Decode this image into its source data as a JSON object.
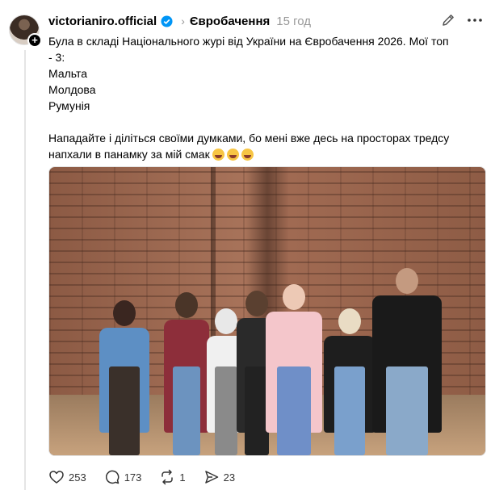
{
  "post": {
    "username": "victorianiro.official",
    "community": "Євробачення",
    "time": "15 год",
    "text_lines": [
      "Була в складі Національного журі від України на Євробачення 2026. Мої топ",
      "- 3:",
      "Мальта",
      "Молдова",
      "Румунія"
    ],
    "paragraph2_line1": "Нападайте і діліться своїми думками, бо мені вже десь на просторах тредсу",
    "paragraph2_line2": "напхали в панамку за мій смак"
  },
  "actions": {
    "likes": "253",
    "replies": "173",
    "reposts": "1",
    "shares": "23"
  },
  "icons": {
    "verified": "verified-badge-icon",
    "edit": "edit-pencil-icon",
    "more": "more-horizontal-icon",
    "like": "heart-icon",
    "reply": "comment-icon",
    "repost": "repost-icon",
    "share": "share-send-icon",
    "emoji": "laughing-face-emoji"
  },
  "colors": {
    "verified": "#0095f6",
    "muted": "#999999"
  }
}
